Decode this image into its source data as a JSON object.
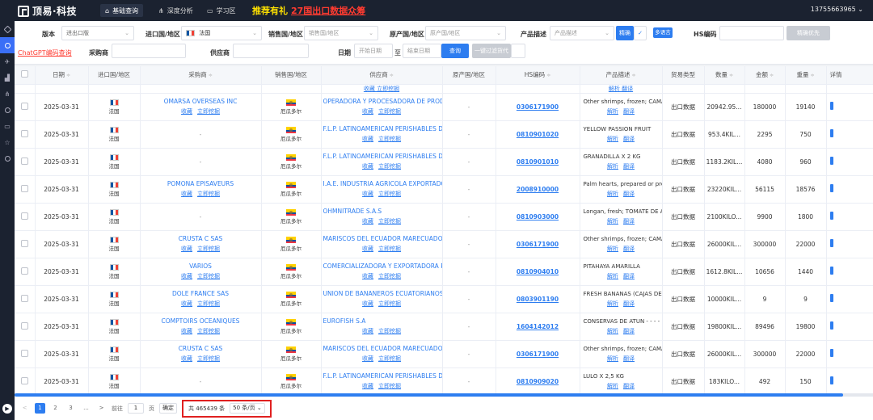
{
  "topbar": {
    "brand": "顶易·科技",
    "nav": [
      {
        "label": "基础查询",
        "active": true
      },
      {
        "label": "深度分析",
        "active": false
      },
      {
        "label": "学习区",
        "active": false
      }
    ],
    "promo_label": "推荐有礼",
    "promo_link": "27国出口数据众筹",
    "user_phone": "13755663965 ⌄"
  },
  "filters": {
    "version_label": "版本",
    "version_value": "进出口版",
    "import_country_label": "进口国/地区",
    "import_country_value": "法国",
    "sales_country_label": "销售国/地区",
    "sales_country_placeholder": "销售国/地区",
    "origin_country_label": "原产国/地区",
    "origin_country_placeholder": "原产国/地区",
    "product_desc_label": "产品描述",
    "product_desc_placeholder": "产品描述",
    "exact_button": "精确",
    "multi_lang_button": "多语言",
    "hs_label": "HS编码",
    "hs_placeholder": "",
    "exact_priority_button": "精确优先",
    "gpt_link": "ChatGPT编码查询",
    "buyer_label": "采购商",
    "supplier_label": "供应商",
    "date_label": "日期",
    "start_date_placeholder": "开始日期",
    "date_sep": "至",
    "end_date_placeholder": "结束日期",
    "query_button": "查询",
    "clear_button": "一键过滤货代"
  },
  "table": {
    "columns": [
      "日期",
      "进口国/地区",
      "采购商",
      "销售国/地区",
      "供应商",
      "原产国/地区",
      "HS编码",
      "产品描述",
      "贸易类型",
      "数量",
      "金额",
      "重量",
      "详情"
    ],
    "sort_mark": "≑",
    "action_collect": "收藏",
    "action_mine": "立即挖掘",
    "action_parse": "解析",
    "action_translate": "翻译",
    "ghost_supplier_actions": "收藏  立即挖掘",
    "ghost_desc_actions": "解析  翻译",
    "rows": [
      {
        "date": "2025-03-31",
        "import_country": "法国",
        "buyer": "OMARSA OVERSEAS INC",
        "buyer_actions": true,
        "sales_country": "厄瓜多尔",
        "supplier": "OPERADORA Y PROCESADORA DE PRODUCTOS",
        "origin": "-",
        "hs": "0306171900",
        "desc": "Other shrimps, frozen; CAMARON",
        "trade_type": "出口数据",
        "qty": "20942.95...",
        "amount": "180000",
        "weight": "19140"
      },
      {
        "date": "2025-03-31",
        "import_country": "法国",
        "buyer": "-",
        "buyer_actions": false,
        "sales_country": "厄瓜多尔",
        "supplier": "F.L.P. LATINOAMERICAN PERISHABLES DEL",
        "origin": "-",
        "hs": "0810901020",
        "desc": "YELLOW PASSION FRUIT",
        "trade_type": "出口数据",
        "qty": "953.4KIL...",
        "amount": "2295",
        "weight": "750"
      },
      {
        "date": "2025-03-31",
        "import_country": "法国",
        "buyer": "-",
        "buyer_actions": false,
        "sales_country": "厄瓜多尔",
        "supplier": "F.L.P. LATINOAMERICAN PERISHABLES DEL",
        "origin": "-",
        "hs": "0810901010",
        "desc": "GRANADILLA X 2 KG",
        "trade_type": "出口数据",
        "qty": "1183.2KIL...",
        "amount": "4080",
        "weight": "960"
      },
      {
        "date": "2025-03-31",
        "import_country": "法国",
        "buyer": "POMONA EPISAVEURS",
        "buyer_actions": true,
        "sales_country": "厄瓜多尔",
        "supplier": "I.A.E. INDUSTRIA AGRICOLA EXPORTADORA",
        "origin": "-",
        "hs": "2008910000",
        "desc": "Palm hearts, prepared or preserved",
        "trade_type": "出口数据",
        "qty": "23220KIL...",
        "amount": "56115",
        "weight": "18576"
      },
      {
        "date": "2025-03-31",
        "import_country": "法国",
        "buyer": "-",
        "buyer_actions": false,
        "sales_country": "厄瓜多尔",
        "supplier": "OHMNITRADE S.A.S",
        "origin": "-",
        "hs": "0810903000",
        "desc": "Longan, fresh; TOMATE DE ARBOL",
        "trade_type": "出口数据",
        "qty": "2100KILO...",
        "amount": "9900",
        "weight": "1800"
      },
      {
        "date": "2025-03-31",
        "import_country": "法国",
        "buyer": "CRUSTA C SAS",
        "buyer_actions": true,
        "sales_country": "厄瓜多尔",
        "supplier": "MARISCOS DEL ECUADOR MARECUADOR",
        "origin": "-",
        "hs": "0306171900",
        "desc": "Other shrimps, frozen; CAMARON",
        "trade_type": "出口数据",
        "qty": "26000KIL...",
        "amount": "300000",
        "weight": "22000"
      },
      {
        "date": "2025-03-31",
        "import_country": "法国",
        "buyer": "VARIOS",
        "buyer_actions": true,
        "sales_country": "厄瓜多尔",
        "supplier": "COMERCIALIZADORA Y EXPORTADORA PITAHAYA",
        "origin": "-",
        "hs": "0810904010",
        "desc": "PITAHAYA AMARILLA",
        "trade_type": "出口数据",
        "qty": "1612.8KIL...",
        "amount": "10656",
        "weight": "1440"
      },
      {
        "date": "2025-03-31",
        "import_country": "法国",
        "buyer": "DOLE FRANCE SAS",
        "buyer_actions": true,
        "sales_country": "厄瓜多尔",
        "supplier": "UNION DE BANANEROS ECUATORIANOS S.A.",
        "origin": "-",
        "hs": "0803901190",
        "desc": "FRESH BANANAS (CAJAS DE",
        "trade_type": "出口数据",
        "qty": "10000KIL...",
        "amount": "9",
        "weight": "9"
      },
      {
        "date": "2025-03-31",
        "import_country": "法国",
        "buyer": "COMPTOIRS OCEANIQUES",
        "buyer_actions": true,
        "sales_country": "厄瓜多尔",
        "supplier": "EUROFISH S.A",
        "origin": "-",
        "hs": "1604142012",
        "desc": "CONSERVAS DE ATUN - - - -",
        "trade_type": "出口数据",
        "qty": "19800KIL...",
        "amount": "89496",
        "weight": "19800"
      },
      {
        "date": "2025-03-31",
        "import_country": "法国",
        "buyer": "CRUSTA C SAS",
        "buyer_actions": true,
        "sales_country": "厄瓜多尔",
        "supplier": "MARISCOS DEL ECUADOR MARECUADOR",
        "origin": "-",
        "hs": "0306171900",
        "desc": "Other shrimps, frozen; CAMARON",
        "trade_type": "出口数据",
        "qty": "26000KIL...",
        "amount": "300000",
        "weight": "22000"
      },
      {
        "date": "2025-03-31",
        "import_country": "法国",
        "buyer": "-",
        "buyer_actions": false,
        "sales_country": "厄瓜多尔",
        "supplier": "F.L.P. LATINOAMERICAN PERISHABLES DEL",
        "origin": "-",
        "hs": "0810909020",
        "desc": "LULO X 2,5 KG",
        "trade_type": "出口数据",
        "qty": "183KILO...",
        "amount": "492",
        "weight": "150"
      }
    ]
  },
  "pagination": {
    "prev": "<",
    "pages": [
      "1",
      "2",
      "3",
      "..."
    ],
    "next": ">",
    "jump_label": "前往",
    "jump_value": "1",
    "page_unit": "页",
    "confirm": "确定",
    "total": "共 465439 条",
    "page_size": "50 条/页"
  },
  "colors": {
    "accent": "#2d7df0",
    "topbar": "#1b2230",
    "promo_yellow": "#ffe100",
    "promo_red": "#ff3b30",
    "highlight_box": "#e02020"
  },
  "icons": [
    "logo-icon",
    "search-icon",
    "chart-icon",
    "book-icon",
    "plane-icon",
    "play-icon"
  ]
}
